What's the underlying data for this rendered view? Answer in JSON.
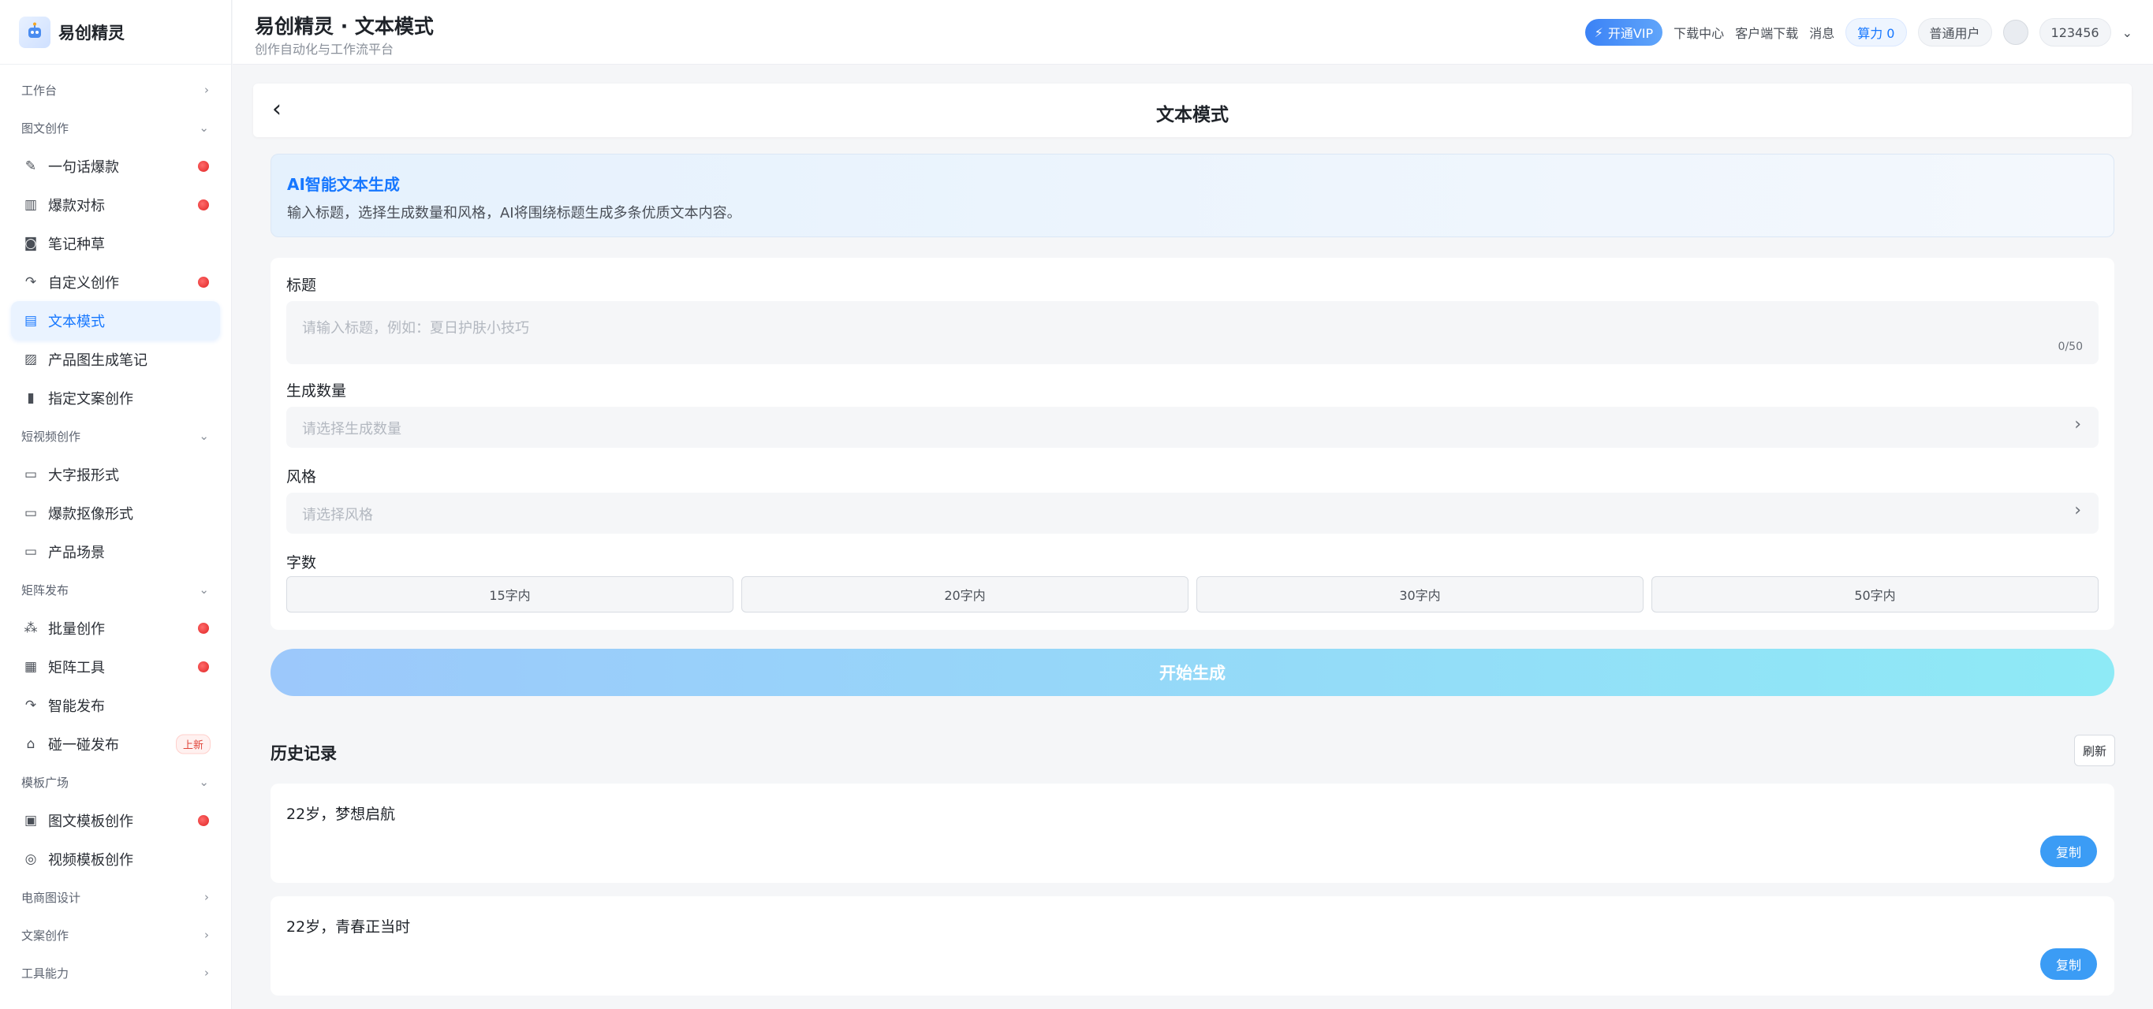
{
  "app": {
    "name": "易创精灵"
  },
  "header": {
    "title": "易创精灵 · 文本模式",
    "subtitle": "创作自动化与工作流平台",
    "vip": "开通VIP",
    "download_center": "下载中心",
    "client_download": "客户端下载",
    "messages": "消息",
    "power": "算力 0",
    "user_type": "普通用户",
    "username": "123456"
  },
  "sidebar": {
    "groups": {
      "workbench": "工作台",
      "graphic": "图文创作",
      "video": "短视频创作",
      "matrix": "矩阵发布",
      "template": "模板广场",
      "ecommerce": "电商图设计",
      "copywriting": "文案创作",
      "tools": "工具能力"
    },
    "items": {
      "one_sentence": "一句话爆款",
      "benchmark": "爆款对标",
      "notes": "笔记种草",
      "custom": "自定义创作",
      "text_mode": "文本模式",
      "product_image": "产品图生成笔记",
      "specified_copy": "指定文案创作",
      "big_text": "大字报形式",
      "cutout": "爆款抠像形式",
      "product_scene": "产品场景",
      "batch": "批量创作",
      "matrix_tools": "矩阵工具",
      "smart_publish": "智能发布",
      "tap_publish": "碰一碰发布",
      "tap_publish_badge": "上新",
      "graphic_template": "图文模板创作",
      "video_template": "视频模板创作"
    }
  },
  "page": {
    "title": "文本模式",
    "banner_title": "AI智能文本生成",
    "banner_desc": "输入标题，选择生成数量和风格，AI将围绕标题生成多条优质文本内容。"
  },
  "form": {
    "title_label": "标题",
    "title_placeholder": "请输入标题，例如：夏日护肤小技巧",
    "title_count": "0/50",
    "count_label": "生成数量",
    "count_placeholder": "请选择生成数量",
    "style_label": "风格",
    "style_placeholder": "请选择风格",
    "words_label": "字数",
    "word_options": [
      "15字内",
      "20字内",
      "30字内",
      "50字内"
    ],
    "start_button": "开始生成"
  },
  "history": {
    "title": "历史记录",
    "refresh": "刷新",
    "copy_label": "复制",
    "items": [
      "22岁，梦想启航",
      "22岁，青春正当时"
    ]
  }
}
